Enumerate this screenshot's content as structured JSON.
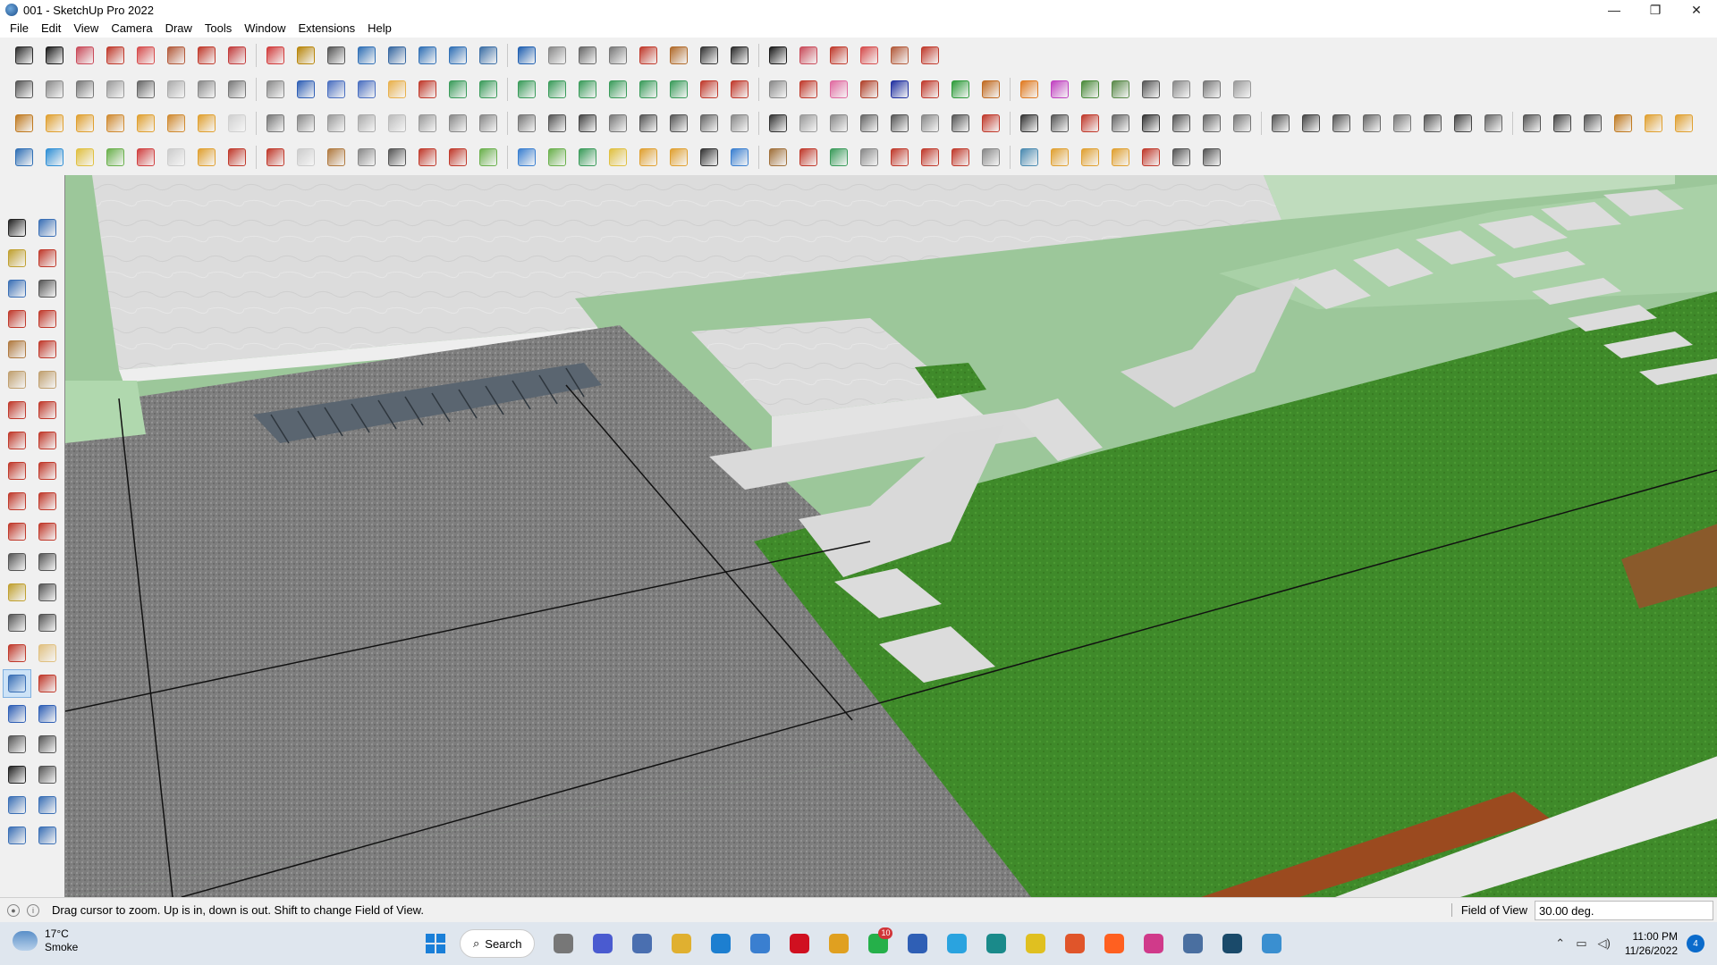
{
  "window": {
    "title": "001 - SketchUp Pro 2022",
    "minimize": "—",
    "maximize": "❐",
    "close": "✕"
  },
  "menu": [
    "File",
    "Edit",
    "View",
    "Camera",
    "Draw",
    "Tools",
    "Window",
    "Extensions",
    "Help"
  ],
  "toolbar_rows": [
    {
      "count": 30,
      "colors": [
        "#2b2b2b",
        "#1a1a1a",
        "#c94b5a",
        "#c0392b",
        "#d64c4c",
        "#b35a3a",
        "#c0392b",
        "#c23b3b",
        "#d13b3b",
        "#b8860b",
        "#555",
        "#2f6fb5",
        "#3566a0",
        "#2f6fb5",
        "#2f6fb5",
        "#3b6ea5",
        "#1f5fb0",
        "#888",
        "#666",
        "#777",
        "#c0392b",
        "#b06a2a",
        "#333"
      ]
    },
    {
      "count": 40,
      "colors": [
        "#555",
        "#888",
        "#777",
        "#999",
        "#666",
        "#aaa",
        "#888",
        "#777",
        "#888",
        "#2f5fb5",
        "#4a6fc0",
        "#4a6fc0",
        "#e8b04c",
        "#c0392b",
        "#3a9b5a",
        "#3a9b5a",
        "#3a9b5a",
        "#3a9b5a",
        "#3a9b5a",
        "#3a9b5a",
        "#3a9b5a",
        "#3a9b5a",
        "#c0392b",
        "#c0392b",
        "#888",
        "#c0392b",
        "#e06aa0",
        "#b0412a",
        "#2030a0",
        "#c0392b",
        "#2e9b3a",
        "#c06a20",
        "#e07a20",
        "#c040c0",
        "#4a8a3a",
        "#5a8a4a"
      ]
    },
    {
      "count": 60,
      "colors": [
        "#c07a20",
        "#e0a030",
        "#e0a030",
        "#d08a30",
        "#e0a030",
        "#d08a30",
        "#e0a030",
        "#d0d0d0",
        "#777",
        "#888",
        "#999",
        "#aaa",
        "#bbb",
        "#999",
        "#888",
        "#888",
        "#777",
        "#555",
        "#444",
        "#777",
        "#555",
        "#555",
        "#666",
        "#888",
        "#333",
        "#999",
        "#888",
        "#666",
        "#555",
        "#888",
        "#555",
        "#c0392b",
        "#333",
        "#555",
        "#c0392b",
        "#666",
        "#333",
        "#555",
        "#666",
        "#777",
        "#555",
        "#444",
        "#555",
        "#666",
        "#777",
        "#555",
        "#444",
        "#666",
        "#555",
        "#444",
        "#555"
      ]
    },
    {
      "count": 39,
      "colors": [
        "#2f6fb5",
        "#2f8fd5",
        "#e0c040",
        "#6ab04c",
        "#d04040",
        "#ccc",
        "#e0a030",
        "#c0392b",
        "#c0392b",
        "#ccc",
        "#b07a40",
        "#888",
        "#555",
        "#c0392b",
        "#c0392b",
        "#6ab04c",
        "#3a7fd0",
        "#6ab04c",
        "#3a9b5a",
        "#e0c040",
        "#e0a030",
        "#e0a030",
        "#333",
        "#3a7fd0",
        "#a0703a",
        "#c0392b",
        "#3a9b5a",
        "#888",
        "#c0392b",
        "#c0392b",
        "#c0392b",
        "#888",
        "#4a8ab0",
        "#e0a030",
        "#e0a030",
        "#e0a030",
        "#c0392b",
        "#555",
        "#555"
      ]
    }
  ],
  "left_tools": [
    "#222",
    "#3a6fb5",
    "#c0a030",
    "#c0392b",
    "#3a6fb5",
    "#555",
    "#c0392b",
    "#c0392b",
    "#b07a40",
    "#c0392b",
    "#c0a070",
    "#c0a070",
    "#c0392b",
    "#c0392b",
    "#c0392b",
    "#c0392b",
    "#c0392b",
    "#c0392b",
    "#c0392b",
    "#c0392b",
    "#c0392b",
    "#c0392b",
    "#555",
    "#555",
    "#c0a030",
    "#555",
    "#555",
    "#555",
    "#c0392b",
    "#e0c080",
    "#3a6fb5",
    "#c0392b",
    "#2f5fb5",
    "#2f5fb5",
    "#555",
    "#555",
    "#222",
    "#555",
    "#3a6fb5",
    "#3a6fb5",
    "#3a6fb5",
    "#3a6fb5"
  ],
  "status": {
    "hint": "Drag cursor to zoom.  Up is in, down is out. Shift to change Field of View.",
    "fov_label": "Field of View",
    "fov_value": "30.00 deg."
  },
  "taskbar": {
    "weather_temp": "17°C",
    "weather_desc": "Smoke",
    "search_label": "Search",
    "whatsapp_badge": "10",
    "time": "11:00 PM",
    "date": "11/26/2022",
    "notifications": "4",
    "apps": [
      "#777",
      "#4a5bd0",
      "#4a6fb0",
      "#e0b030",
      "#1d7fd0",
      "#3a7fd0",
      "#d01020",
      "#e0a020",
      "#25b04a",
      "#2f5fb5",
      "#2aa3df",
      "#1a8a8a",
      "#e0c020",
      "#e0552a",
      "#ff6020",
      "#d03a8a",
      "#4a6fa0",
      "#1a4a6a",
      "#3a8fd0"
    ]
  }
}
